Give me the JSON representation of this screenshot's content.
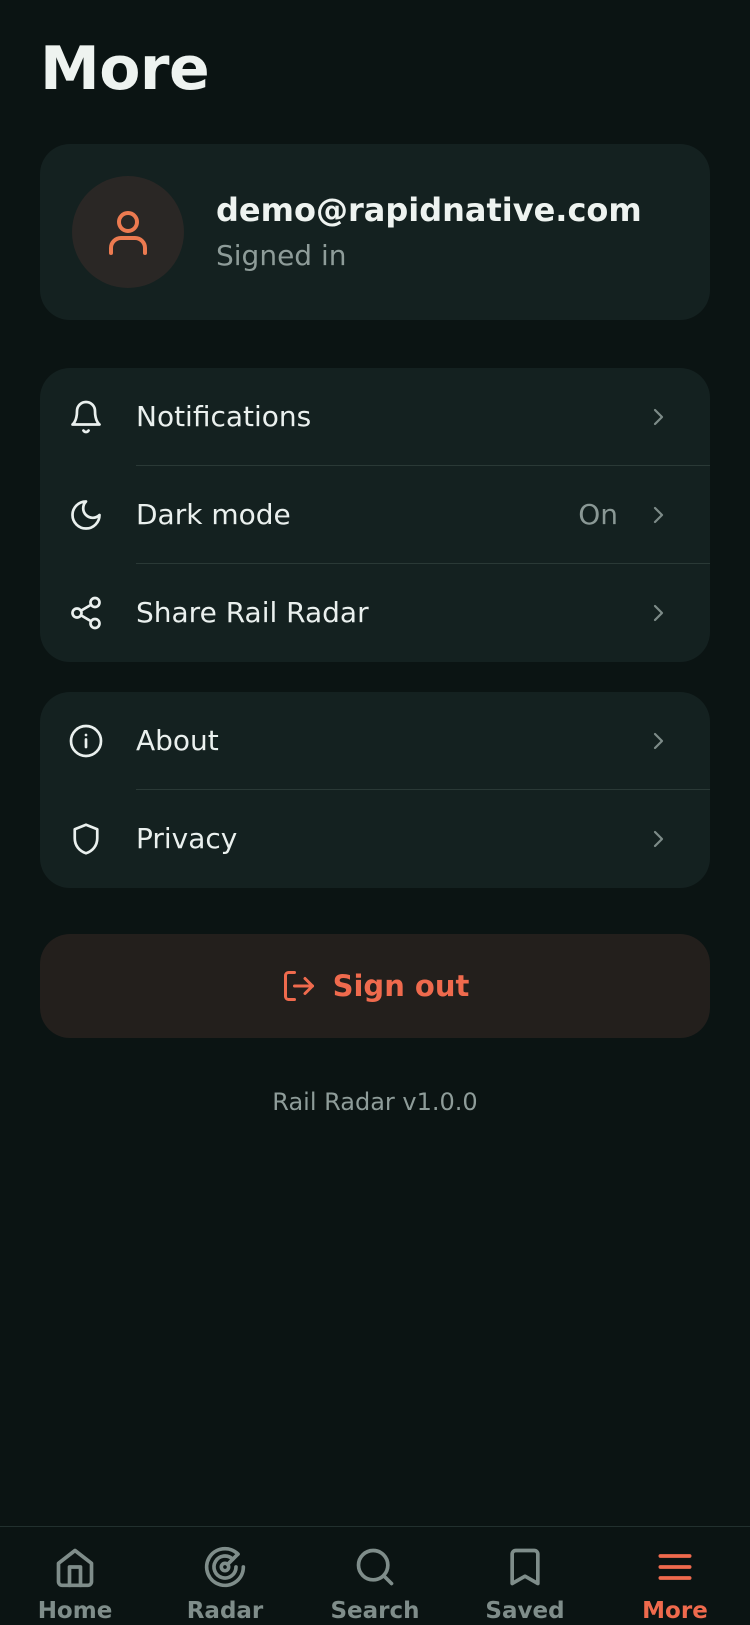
{
  "page": {
    "title": "More"
  },
  "profile": {
    "email": "demo@rapidnative.com",
    "status": "Signed in",
    "avatar_icon": "user-icon"
  },
  "settings_group": {
    "items": [
      {
        "label": "Notifications",
        "icon": "bell-icon",
        "value": ""
      },
      {
        "label": "Dark mode",
        "icon": "moon-icon",
        "value": "On"
      },
      {
        "label": "Share Rail Radar",
        "icon": "share-icon",
        "value": ""
      }
    ]
  },
  "info_group": {
    "items": [
      {
        "label": "About",
        "icon": "info-icon"
      },
      {
        "label": "Privacy",
        "icon": "shield-icon"
      }
    ]
  },
  "signout": {
    "label": "Sign out",
    "icon": "log-out-icon"
  },
  "footer": {
    "version": "Rail Radar v1.0.0"
  },
  "tabbar": {
    "active": "More",
    "tabs": [
      {
        "label": "Home",
        "icon": "home-icon"
      },
      {
        "label": "Radar",
        "icon": "radar-icon"
      },
      {
        "label": "Search",
        "icon": "search-icon"
      },
      {
        "label": "Saved",
        "icon": "bookmark-icon"
      },
      {
        "label": "More",
        "icon": "menu-icon"
      }
    ]
  },
  "colors": {
    "background": "#0b1413",
    "card": "#142120",
    "accent": "#ef6a4d",
    "text_primary": "#eef3f0",
    "text_secondary": "#8e9c99"
  }
}
